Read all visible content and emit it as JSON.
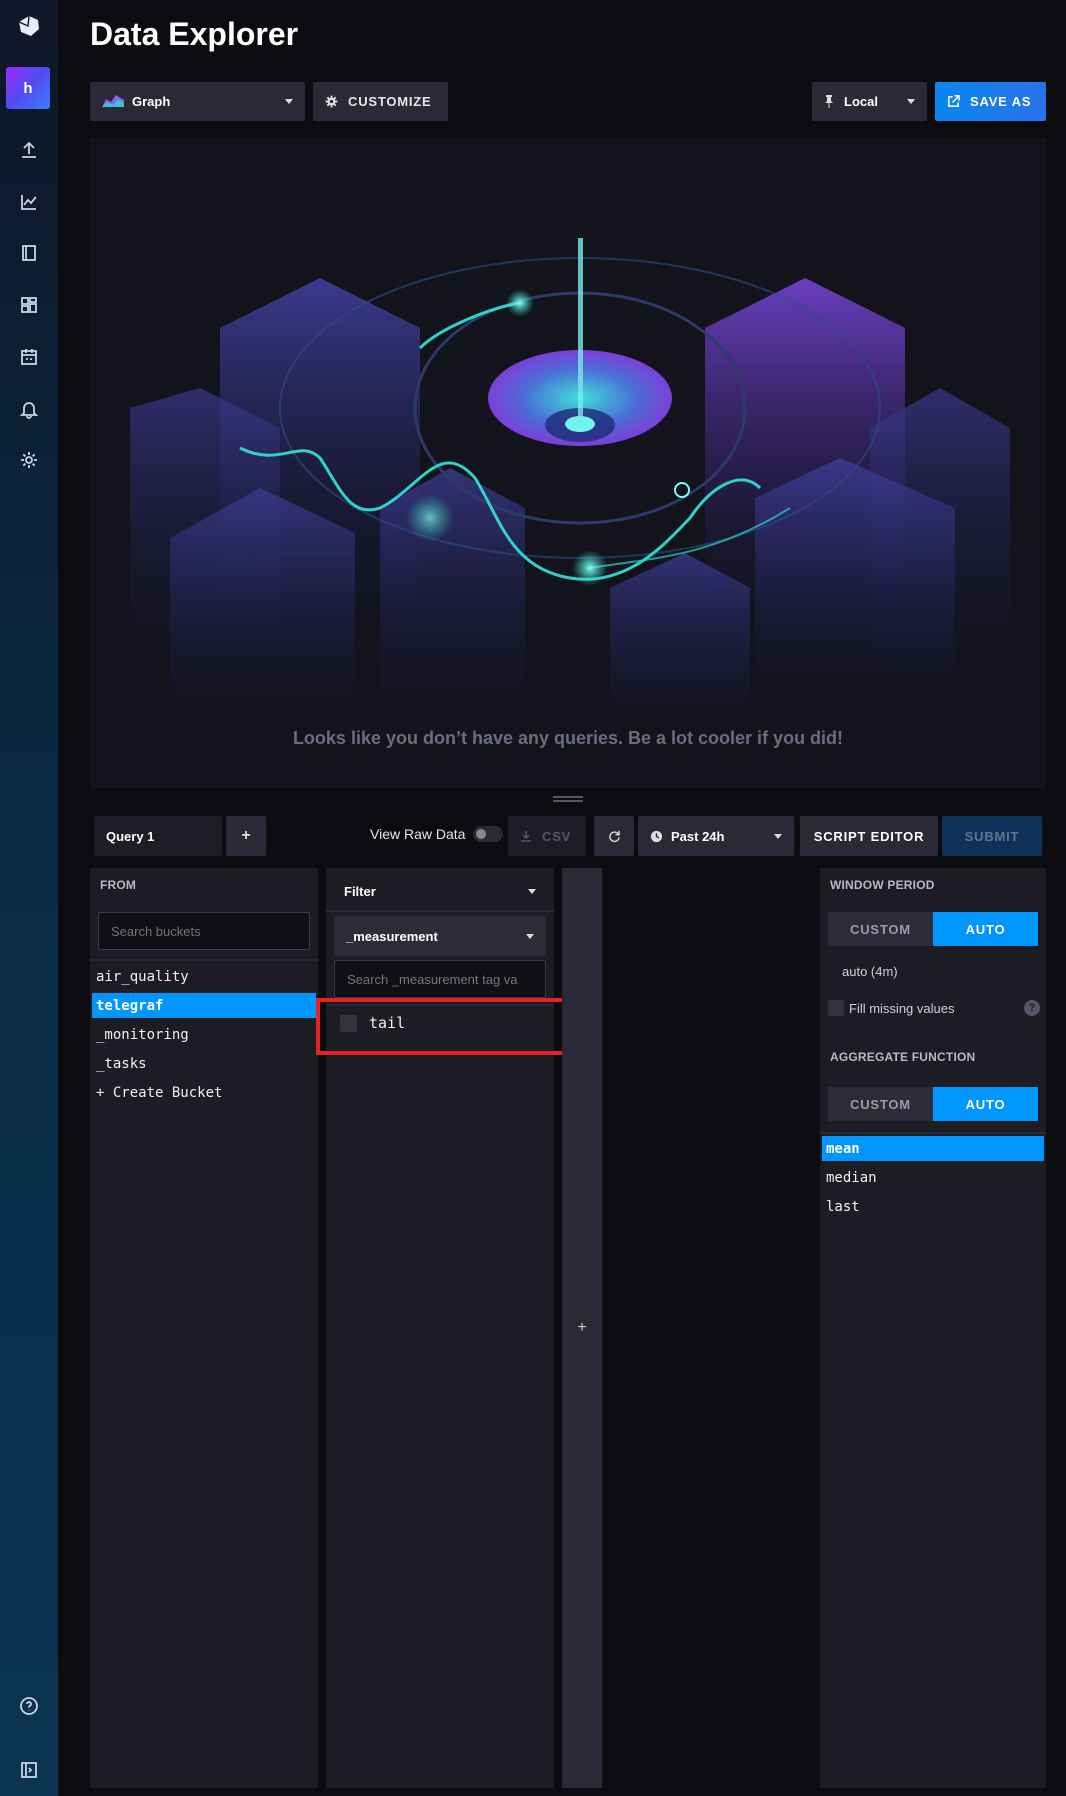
{
  "header": {
    "title": "Data Explorer",
    "view_type": "Graph",
    "customize_label": "CUSTOMIZE",
    "timezone_label": "Local",
    "save_as_label": "SAVE AS"
  },
  "sidebar": {
    "avatar_letter": "h",
    "icons": [
      "upload-icon",
      "graph-icon",
      "notebook-icon",
      "dashboards-icon",
      "tasks-calendar-icon",
      "alerts-bell-icon",
      "settings-gear-icon",
      "help-icon",
      "collapse-icon"
    ]
  },
  "graph": {
    "empty_message": "Looks like you don’t have any queries. Be a lot cooler if you did!"
  },
  "query_bar": {
    "query_tab": "Query 1",
    "add_label": "+",
    "raw_data_label": "View Raw Data",
    "raw_data_on": false,
    "csv_label": "CSV",
    "time_range": "Past 24h",
    "script_editor_label": "SCRIPT EDITOR",
    "submit_label": "SUBMIT"
  },
  "from_panel": {
    "header": "FROM",
    "search_placeholder": "Search buckets",
    "buckets": [
      "air_quality",
      "telegraf",
      "_monitoring",
      "_tasks",
      "+ Create Bucket"
    ],
    "selected_bucket": "telegraf"
  },
  "filter_panel": {
    "mode": "Filter",
    "tag_key": "_measurement",
    "search_placeholder": "Search _measurement tag va",
    "values": [
      "tail"
    ]
  },
  "add_filter_label": "+",
  "aggregate_panel": {
    "window_header": "WINDOW PERIOD",
    "custom_label": "CUSTOM",
    "auto_label": "AUTO",
    "window_value": "auto (4m)",
    "fill_missing_label": "Fill missing values",
    "help_glyph": "?",
    "function_header": "AGGREGATE FUNCTION",
    "functions": [
      "mean",
      "median",
      "last"
    ],
    "selected_function": "mean"
  },
  "colors": {
    "accent": "#0095ff",
    "highlight": "#e52326",
    "background": "#0b0b10",
    "panel": "#1c1c25"
  }
}
